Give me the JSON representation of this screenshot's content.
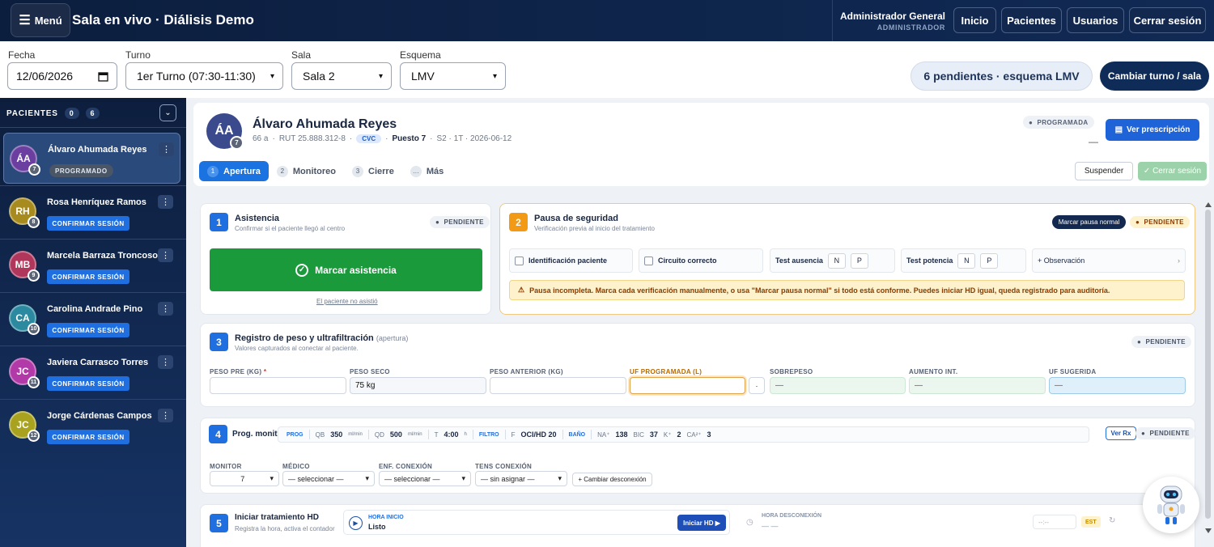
{
  "topbar": {
    "menu_label": "Menú",
    "title": "Sala en vivo · Diálisis Demo",
    "user_name": "Administrador General",
    "user_role": "ADMINISTRADOR",
    "nav": [
      "Inicio",
      "Pacientes",
      "Usuarios",
      "Cerrar sesión"
    ]
  },
  "filters": {
    "fecha_label": "Fecha",
    "fecha_value": "12/06/2026",
    "turno_label": "Turno",
    "turno_value": "1er Turno (07:30-11:30)",
    "sala_label": "Sala",
    "sala_value": "Sala 2",
    "esquema_label": "Esquema",
    "esquema_value": "LMV",
    "pendientes": "6 pendientes · esquema LMV",
    "cambiar_btn": "Cambiar turno / sala"
  },
  "sidebar": {
    "heading": "PACIENTES",
    "count_a": "0",
    "count_b": "6",
    "patients": [
      {
        "initials": "ÁA",
        "num": "7",
        "name": "Álvaro Ahumada Reyes",
        "tag": "PROGRAMADO",
        "color": "#6a3fa0"
      },
      {
        "initials": "RH",
        "num": "8",
        "name": "Rosa Henríquez Ramos",
        "tag": "CONFIRMAR SESIÓN",
        "color": "#a88b1e"
      },
      {
        "initials": "MB",
        "num": "9",
        "name": "Marcela Barraza Troncoso",
        "tag": "CONFIRMAR SESIÓN",
        "color": "#b0365c"
      },
      {
        "initials": "CA",
        "num": "10",
        "name": "Carolina Andrade Pino",
        "tag": "CONFIRMAR SESIÓN",
        "color": "#2b8aa0"
      },
      {
        "initials": "JC",
        "num": "11",
        "name": "Javiera Carrasco Torres",
        "tag": "CONFIRMAR SESIÓN",
        "color": "#b23aa8"
      },
      {
        "initials": "JC",
        "num": "12",
        "name": "Jorge Cárdenas Campos",
        "tag": "CONFIRMAR SESIÓN",
        "color": "#a8a21e"
      }
    ]
  },
  "patient": {
    "initials": "ÁA",
    "num": "7",
    "name": "Álvaro Ahumada Reyes",
    "age": "66 a",
    "rut": "RUT 25.888.312-8",
    "access": "CVC",
    "puesto": "Puesto 7",
    "session": "S2 · 1T · 2026-06-12",
    "status": "PROGRAMADA",
    "dash": "—",
    "rx_btn": "Ver prescripción",
    "tabs": [
      {
        "n": "1",
        "label": "Apertura"
      },
      {
        "n": "2",
        "label": "Monitoreo"
      },
      {
        "n": "3",
        "label": "Cierre"
      },
      {
        "n": "…",
        "label": "Más"
      }
    ],
    "suspend_btn": "Suspender",
    "close_btn": "✓ Cerrar sesión"
  },
  "asistencia": {
    "num": "1",
    "title": "Asistencia",
    "sub": "Confirmar si el paciente llegó al centro",
    "status": "PENDIENTE",
    "btn": "Marcar asistencia",
    "link": "El paciente no asistió"
  },
  "pausa": {
    "num": "2",
    "title": "Pausa de seguridad",
    "sub": "Verificación previa al inicio del tratamiento",
    "btn": "Marcar pausa normal",
    "status": "PENDIENTE",
    "id_label": "Identificación paciente",
    "circuito_label": "Circuito correcto",
    "ausencia_label": "Test ausencia",
    "potencia_label": "Test potencia",
    "n": "N",
    "p": "P",
    "obs": "+ Observación",
    "warning": "Pausa incompleta. Marca cada verificación manualmente, o usa \"Marcar pausa normal\" si todo está conforme. Puedes iniciar HD igual, queda registrado para auditoría."
  },
  "peso": {
    "num": "3",
    "title": "Registro de peso y ultrafiltración",
    "title_suffix": "(apertura)",
    "sub": "Valores capturados al conectar al paciente.",
    "status": "PENDIENTE",
    "fields": {
      "peso_pre": "PESO PRE (KG)",
      "peso_seco": "PESO SECO",
      "peso_seco_value": "75 kg",
      "peso_anterior": "PESO ANTERIOR (KG)",
      "uf_prog": "UF PROGRAMADA (L)",
      "sobrepeso": "SOBREPESO",
      "aumento": "AUMENTO INT.",
      "uf_sug": "UF SUGERIDA",
      "empty": "—",
      "dot": "·",
      "req": "*"
    }
  },
  "monitor": {
    "num": "4",
    "title": "Prog. monitor",
    "prog_tag": "PROG",
    "qb_label": "QB",
    "qb": "350",
    "qb_unit": "ml/min",
    "qd_label": "QD",
    "qd": "500",
    "qd_unit": "ml/min",
    "t_label": "T",
    "t": "4:00",
    "t_unit": "h",
    "filtro_tag": "FILTRO",
    "f_label": "F",
    "f": "OCI/HD 20",
    "bano_tag": "BAÑO",
    "na_label": "NA⁺",
    "na": "138",
    "bic_label": "BIC",
    "bic": "37",
    "k_label": "K⁺",
    "k": "2",
    "ca_label": "CA²⁺",
    "ca": "3",
    "vrx_btn": "Ver Rx",
    "status": "PENDIENTE",
    "monitor_label": "MONITOR",
    "monitor_value": "7",
    "medico_label": "MÉDICO",
    "medico_value": "— seleccionar —",
    "enf_label": "ENF. CONEXIÓN",
    "enf_value": "— seleccionar —",
    "tens_label": "TENS CONEXIÓN",
    "tens_value": "— sin asignar —",
    "cambiar_btn": "+ Cambiar desconexión"
  },
  "iniciar": {
    "num": "5",
    "title": "Iniciar tratamiento HD",
    "sub": "Registra la hora, activa el contador",
    "hora_label": "HORA INICIO",
    "hora_value": "Listo",
    "btn": "Iniciar HD ▶",
    "desc_label": "HORA DESCONEXIÓN",
    "desc_value": "— —",
    "time_ph": "--:--",
    "est": "EST"
  },
  "icons": [
    "menu-icon",
    "calendar-icon",
    "chevron-down-icon",
    "kebab-icon",
    "document-icon",
    "check-icon",
    "warning-icon",
    "play-icon",
    "clock-icon",
    "refresh-icon",
    "robot-icon"
  ]
}
